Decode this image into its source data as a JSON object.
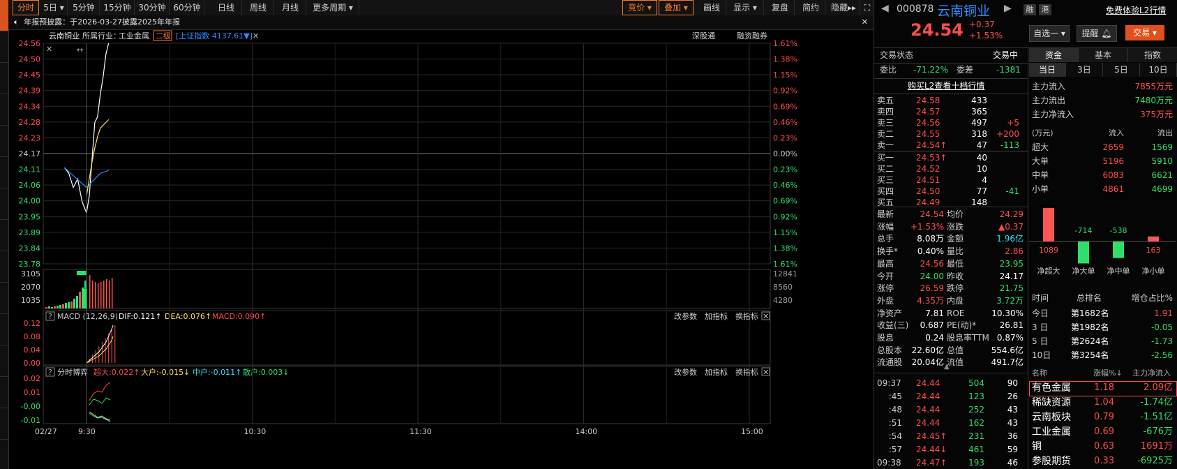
{
  "toolbar": {
    "periods": [
      "分时",
      "5日",
      "5分钟",
      "15分钟",
      "30分钟",
      "60分钟",
      "日线",
      "周线",
      "月线",
      "更多周期"
    ],
    "right_items": [
      "竞价",
      "叠加",
      "画线",
      "显示",
      "复盘",
      "简约",
      "隐藏"
    ]
  },
  "notice": {
    "text": "年报预披露：于2026-03-27披露2025年年报"
  },
  "header": {
    "name": "云南铜业",
    "industry_label": "所属行业：",
    "industry": "工业金属",
    "level_badge": "二级",
    "index_text": "[上证指数 4137.61▼]",
    "links": [
      "深股通",
      "融资融券"
    ]
  },
  "price_axis": {
    "left": [
      "24.56",
      "24.50",
      "24.45",
      "24.39",
      "24.34",
      "24.28",
      "24.23",
      "24.17",
      "24.11",
      "24.06",
      "24.00",
      "23.95",
      "23.89",
      "23.84",
      "23.78"
    ],
    "right": [
      "1.61%",
      "1.38%",
      "1.15%",
      "0.92%",
      "0.69%",
      "0.46%",
      "0.23%",
      "0.00%",
      "0.23%",
      "0.46%",
      "0.69%",
      "0.92%",
      "1.15%",
      "1.38%",
      "1.61%"
    ]
  },
  "volume_axis": {
    "left": [
      "3105",
      "2070",
      "1035"
    ],
    "right": [
      "12841",
      "8560",
      "4280"
    ]
  },
  "macd": {
    "title": "MACD (12,26,9)",
    "dif": "DIF:0.121↑",
    "dea": "DEA:0.076↑",
    "macd": "MACD:0.090↑",
    "axis": [
      "0.12",
      "0.08",
      "0.04",
      "0.00"
    ],
    "actions": [
      "改参数",
      "加指标",
      "换指标"
    ]
  },
  "game": {
    "title": "分时博弈",
    "super": "超大:0.022↑",
    "big": "大户:-0.015↓",
    "mid": "中户:-0.011↑",
    "retail": "散户:0.003↓",
    "axis": [
      "0.02",
      "0.01",
      "-0.00",
      "-0.01"
    ],
    "actions": [
      "改参数",
      "加指标",
      "换指标"
    ]
  },
  "time_axis": [
    "02/27",
    "9:30",
    "10:30",
    "11:30",
    "14:00",
    "15:00"
  ],
  "chart_data": {
    "type": "line",
    "title": "",
    "ylim": [
      23.78,
      24.56
    ],
    "prev_close": 24.17,
    "series": [
      {
        "name": "",
        "color": "#ffffff",
        "x": [
          "09:25",
          "09:26",
          "09:27",
          "09:28",
          "09:29",
          "09:30",
          "09:31",
          "09:32",
          "09:33",
          "09:34",
          "09:35",
          "09:36",
          "09:37",
          "09:38"
        ],
        "values": [
          24.12,
          24.1,
          24.05,
          24.08,
          24.0,
          23.96,
          24.02,
          24.15,
          24.28,
          24.3,
          24.38,
          24.44,
          24.52,
          24.56
        ]
      },
      {
        "name": "",
        "color": "#1e90ff",
        "x": [
          "09:25",
          "09:30",
          "09:31",
          "09:32",
          "09:33",
          "09:34",
          "09:35",
          "09:38"
        ],
        "values": [
          24.12,
          24.05,
          24.06,
          24.07,
          24.08,
          24.09,
          24.1,
          24.11
        ]
      },
      {
        "name": "",
        "color": "#ffe14d",
        "x": [
          "09:30",
          "09:31",
          "09:32",
          "09:33",
          "09:34",
          "09:35",
          "09:38"
        ],
        "values": [
          24.02,
          24.08,
          24.14,
          24.19,
          24.23,
          24.26,
          24.29
        ]
      }
    ]
  },
  "right": {
    "code": "000878",
    "name": "云南铜业",
    "tags": [
      "融",
      "港"
    ],
    "free_l2": "免费体验L2行情",
    "price": "24.54",
    "change": "+0.37",
    "change_pct": "+1.53%",
    "buttons": [
      "自选一",
      "提醒",
      "交易"
    ],
    "status_label": "交易状态",
    "status_value": "交易中",
    "weibi_label": "委比",
    "weibi": "-71.22%",
    "weicha_label": "委差",
    "weicha": "-1381",
    "buy_l2": "购买L2查看十档行情",
    "asks": [
      {
        "label": "卖五",
        "price": "24.58",
        "vol": "433",
        "chg": ""
      },
      {
        "label": "卖四",
        "price": "24.57",
        "vol": "365",
        "chg": ""
      },
      {
        "label": "卖三",
        "price": "24.56",
        "vol": "497",
        "chg": "+5"
      },
      {
        "label": "卖二",
        "price": "24.55",
        "vol": "318",
        "chg": "+200"
      },
      {
        "label": "卖一",
        "price": "24.54↑",
        "vol": "47",
        "chg": "-113"
      }
    ],
    "bids": [
      {
        "label": "买一",
        "price": "24.53↑",
        "vol": "40",
        "chg": ""
      },
      {
        "label": "买二",
        "price": "24.52",
        "vol": "10",
        "chg": ""
      },
      {
        "label": "买三",
        "price": "24.51",
        "vol": "4",
        "chg": ""
      },
      {
        "label": "买四",
        "price": "24.50",
        "vol": "77",
        "chg": "-41"
      },
      {
        "label": "买五",
        "price": "24.49",
        "vol": "148",
        "chg": ""
      }
    ],
    "stats": [
      [
        "最新",
        "24.54",
        "均价",
        "24.29"
      ],
      [
        "涨幅",
        "+1.53%",
        "涨跌",
        "▲0.37"
      ],
      [
        "总手",
        "8.08万",
        "金额",
        "1.96亿"
      ],
      [
        "换手*",
        "0.40%",
        "量比",
        "2.86"
      ],
      [
        "最高",
        "24.56",
        "最低",
        "23.95"
      ],
      [
        "今开",
        "24.00",
        "昨收",
        "24.17"
      ],
      [
        "涨停",
        "26.59",
        "跌停",
        "21.75"
      ],
      [
        "外盘",
        "4.35万",
        "内盘",
        "3.72万"
      ],
      [
        "净资产",
        "7.81",
        "ROE",
        "10.30%"
      ],
      [
        "收益(三)",
        "0.687",
        "PE(动)*",
        "26.81"
      ],
      [
        "股息",
        "0.24",
        "股息率TTM",
        "0.87%"
      ],
      [
        "总股本",
        "22.60亿",
        "总值",
        "554.6亿"
      ],
      [
        "流通股",
        "20.04亿",
        "流值",
        "491.7亿"
      ]
    ],
    "ticks": [
      [
        "09:37",
        "24.44",
        "504",
        "90"
      ],
      [
        ":45",
        "24.44",
        "123",
        "26"
      ],
      [
        ":48",
        "24.44",
        "252",
        "43"
      ],
      [
        ":51",
        "24.44",
        "162",
        "43"
      ],
      [
        ":54",
        "24.45↑",
        "231",
        "36"
      ],
      [
        ":57",
        "24.44↓",
        "461",
        "59"
      ],
      [
        "09:38",
        "24.47↑",
        "193",
        "46"
      ]
    ],
    "tabs": [
      "资金",
      "基本",
      "指数"
    ],
    "subtabs": [
      "当日",
      "3日",
      "5日",
      "10日"
    ],
    "flow": [
      [
        "主力流入",
        "7855万元"
      ],
      [
        "主力流出",
        "7480万元"
      ],
      [
        "主力净流入",
        "375万元"
      ]
    ],
    "unit": "(万元)",
    "flow_head": [
      "流入",
      "流出"
    ],
    "flow_table": [
      [
        "超大",
        "2659",
        "1569"
      ],
      [
        "大单",
        "5196",
        "5910"
      ],
      [
        "中单",
        "6083",
        "6621"
      ],
      [
        "小单",
        "4861",
        "4699"
      ]
    ],
    "net_bars": {
      "values": [
        1089,
        -714,
        -538,
        163
      ],
      "labels": [
        "净超大",
        "净大单",
        "净中单",
        "净小单"
      ]
    },
    "rank_head": [
      "时间",
      "总排名",
      "增仓占比%"
    ],
    "rank": [
      [
        "今日",
        "第1682名",
        "1.91"
      ],
      [
        "3 日",
        "第1982名",
        "-0.05"
      ],
      [
        "5 日",
        "第2624名",
        "-1.73"
      ],
      [
        "10日",
        "第3254名",
        "-2.56"
      ]
    ],
    "sector_head": [
      "名称",
      "涨幅%↓",
      "主力净流入"
    ],
    "sectors": [
      [
        "有色金属",
        "1.18",
        "2.09亿"
      ],
      [
        "稀缺资源",
        "1.04",
        "-1.74亿"
      ],
      [
        "云南板块",
        "0.79",
        "-1.51亿"
      ],
      [
        "工业金属",
        "0.69",
        "-676万"
      ],
      [
        "铜",
        "0.63",
        "1691万"
      ],
      [
        "参股期货",
        "0.33",
        "-6925万"
      ]
    ]
  }
}
